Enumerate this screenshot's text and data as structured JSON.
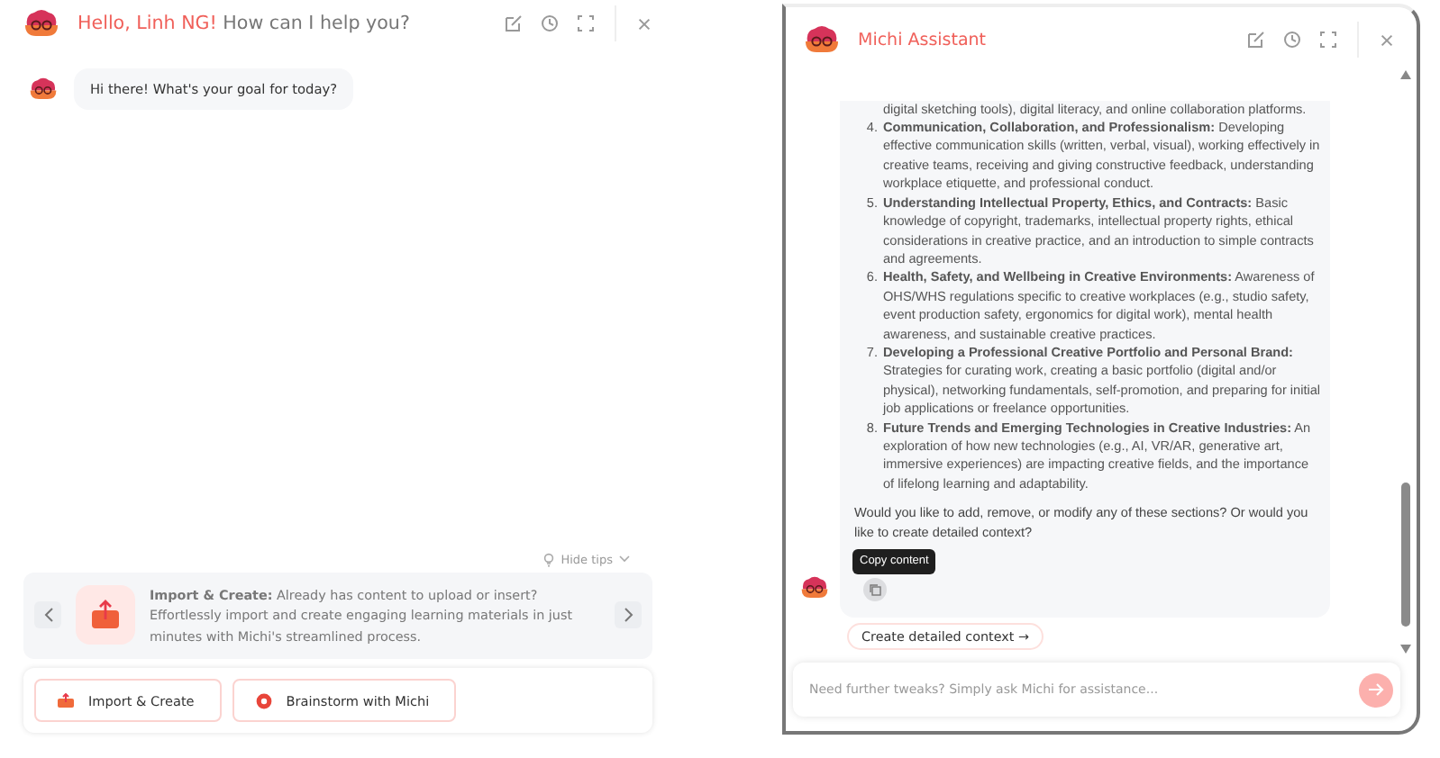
{
  "left_panel": {
    "greeting": "Hello, Linh NG!",
    "title": "How can I help you?",
    "messages": [
      {
        "text": "Hi there! What's your goal for today?"
      }
    ],
    "hide_tips": "Hide tips",
    "tip": {
      "text": "**Import & Create:** Already has content to upload or insert? Effortlessly import and create engaging learning materials in just minutes with Michi's streamlined process."
    },
    "actions": [
      {
        "label": "Import & Create",
        "kind": "import"
      },
      {
        "label": "Brainstorm with Michi",
        "kind": "brainstorm"
      }
    ]
  },
  "right_panel": {
    "title": "Michi Assistant",
    "list_continuation": "digital sketching tools), digital literacy, and online collaboration platforms.",
    "list": [
      {
        "number": "4.",
        "text": "**Communication, Collaboration, and Professionalism:** Developing effective communication skills (written, verbal, visual), working effectively in creative teams, receiving and giving constructive feedback, understanding workplace etiquette, and professional conduct."
      },
      {
        "number": "5.",
        "text": "**Understanding Intellectual Property, Ethics, and Contracts:** Basic knowledge of copyright, trademarks, intellectual property rights, ethical considerations in creative practice, and an introduction to simple contracts and agreements."
      },
      {
        "number": "6.",
        "text": "**Health, Safety, and Wellbeing in Creative Environments:** Awareness of OHS/WHS regulations specific to creative workplaces (e.g., studio safety, event production safety, ergonomics for digital work), mental health awareness, and sustainable creative practices."
      },
      {
        "number": "7.",
        "text": "**Developing a Professional Creative Portfolio and Personal Brand:** Strategies for curating work, creating a basic portfolio (digital and/or physical), networking fundamentals, self-promotion, and preparing for initial job applications or freelance opportunities."
      },
      {
        "number": "8.",
        "text": "**Future Trends and Emerging Technologies in Creative Industries:** An exploration of how new technologies (e.g., AI, VR/AR, generative art, immersive experiences) are impacting creative fields, and the importance of lifelong learning and adaptability."
      }
    ],
    "closing": "Would you like to add, remove, or modify any of these sections? Or would you like to create detailed context?",
    "tooltip": "Copy content",
    "suggestion": "Create detailed context →",
    "input": {
      "placeholder": "Need further tweaks? Simply ask Michi for assistance..."
    }
  }
}
